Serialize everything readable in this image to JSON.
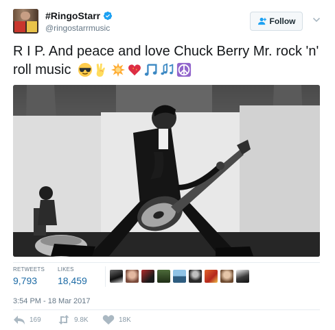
{
  "author": {
    "display_name": "#RingoStarr",
    "handle": "@ringostarrmusic",
    "verified": true,
    "avatar_icon": "avatar-photo"
  },
  "header": {
    "follow_label": "Follow",
    "follow_icon": "add-user-icon",
    "menu_icon": "chevron-down-icon"
  },
  "tweet": {
    "text": "R I P. And peace and love Chuck Berry Mr. rock 'n' roll music",
    "emojis": [
      "sunglasses-face-emoji",
      "victory-hand-emoji",
      "glowing-star-emoji",
      "sparkling-heart-emoji",
      "musical-note-emoji",
      "musical-notes-emoji",
      "peace-symbol-emoji"
    ],
    "media_description": "black-and-white photo of guitarist"
  },
  "stats": {
    "retweets_label": "RETWEETS",
    "retweets_value": "9,793",
    "likes_label": "LIKES",
    "likes_value": "18,459",
    "liker_count": 9
  },
  "timestamp": "3:54 PM - 18 Mar 2017",
  "actions": {
    "reply_count": "169",
    "retweet_count": "9.8K",
    "like_count": "18K"
  },
  "colors": {
    "link_blue": "#1b6aa5",
    "verified_blue": "#1da1f2",
    "muted_gray": "#657786",
    "text": "#14171a"
  }
}
